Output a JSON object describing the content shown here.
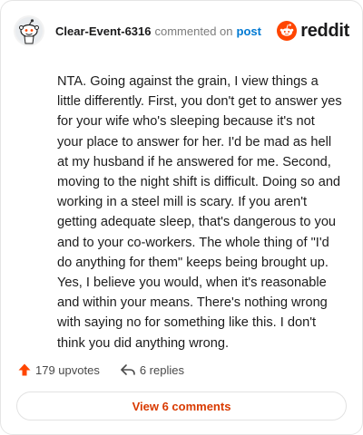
{
  "header": {
    "username": "Clear-Event-6316",
    "action": "commented on",
    "post_link": "post",
    "brand": "reddit"
  },
  "comment": {
    "text": "NTA. Going against the grain, I view things a little differently. First, you don't get to answer yes for your wife who's sleeping because it's not your place to answer for her. I'd be mad as hell at my husband if he answered for me. Second, moving to the night shift is difficult. Doing so and working in a steel mill is scary. If you aren't getting adequate sleep, that's dangerous to you and to your co-workers. The whole thing of \"I'd do anything for them\" keeps being brought up. Yes, I believe you would, when it's reasonable and within your means. There's nothing wrong with saying no for something like this. I don't think you did anything wrong."
  },
  "footer": {
    "upvotes": "179 upvotes",
    "replies": "6 replies"
  },
  "view_button": "View 6 comments",
  "colors": {
    "accent": "#ff4500",
    "link": "#0079d3",
    "button_text": "#d93a00"
  },
  "icons": {
    "avatar": "snoo-avatar-icon",
    "brand": "reddit-logo-icon",
    "upvote": "upvote-arrow-icon",
    "reply": "reply-arrow-icon"
  }
}
